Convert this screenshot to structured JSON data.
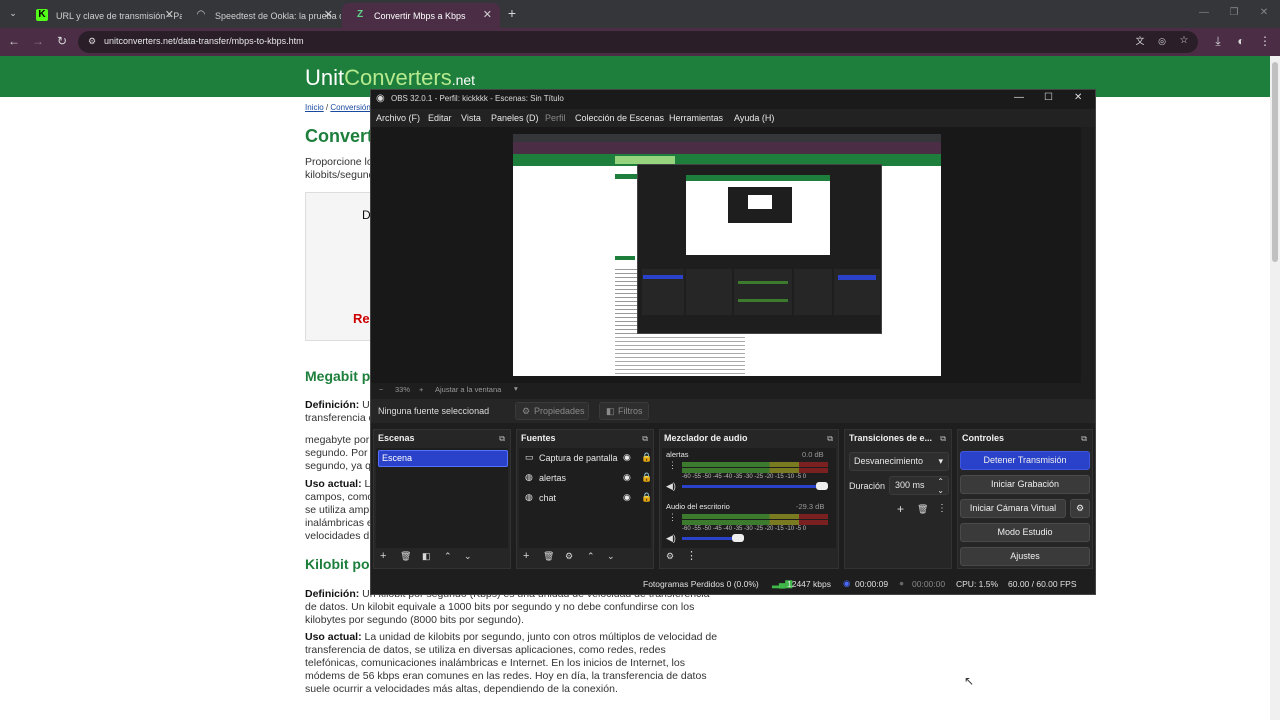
{
  "browser": {
    "tabs": [
      {
        "title": "URL y clave de transmisión - Pa",
        "icon": "kick-logo"
      },
      {
        "title": "Speedtest de Ookla: la prueba d",
        "icon": "speedtest-logo"
      },
      {
        "title": "Convertir Mbps a Kbps",
        "icon": "unitconverters-logo"
      }
    ],
    "url": "unitconverters.net/data-transfer/mbps-to-kbps.htm",
    "accent": "#4b2e46"
  },
  "page": {
    "logo_unit": "Unit",
    "logo_converters": "Converters",
    "logo_net": ".net",
    "breadcrumb_home": "Inicio",
    "breadcrumb_sep": " / ",
    "breadcrumb_conv": "Conversión d",
    "title": "Convert",
    "intro_1": "Proporcione lo",
    "intro_2": "kilobits/segund",
    "card_letter": "D",
    "card_red": "Re",
    "h_megabit": "Megabit p",
    "def_label": "Definición:",
    "def_1": "U",
    "def_2": "transferencia d",
    "mb_1": "megabyte por",
    "mb_2": "segundo. Por",
    "mb_3": "segundo, ya q",
    "uso_label": "Uso actual:",
    "uso_1": "L",
    "uso_2": "campos, como",
    "uso_3": "se utiliza ampl",
    "uso_4": "inalámbricas e",
    "uso_5": "velocidades d",
    "h_kilobit": "Kilobit po",
    "kb_def_1": "Un kilobit por segundo (Kbps) es una unidad de velocidad de transferencia",
    "kb_def_2": "de datos. Un kilobit equivale a 1000 bits por segundo y no debe confundirse con los",
    "kb_def_3": "kilobytes por segundo (8000 bits por segundo).",
    "kb_uso_1": "La unidad de kilobits por segundo, junto con otros múltiplos de velocidad de",
    "kb_uso_2": "transferencia de datos, se utiliza en diversas aplicaciones, como redes, redes",
    "kb_uso_3": "telefónicas, comunicaciones inalámbricas e Internet. En los inicios de Internet, los",
    "kb_uso_4": "módems de 56 kbps eran comunes en las redes. Hoy en día, la transferencia de datos",
    "kb_uso_5": "suele ocurrir a velocidades más altas, dependiendo de la conexión.",
    "accent": "#1d7f3b"
  },
  "obs": {
    "title": "OBS 32.0.1 - Perfil: kickkkk - Escenas: Sin Título",
    "menu": [
      "Archivo (F)",
      "Editar",
      "Vista",
      "Paneles (D)",
      "Perfil",
      "Colección de Escenas",
      "Herramientas",
      "Ayuda (H)"
    ],
    "zoom": "33%",
    "fit": "Ajustar a la ventana",
    "no_source": "Ninguna fuente seleccionad",
    "properties": "Propiedades",
    "filters": "Filtros",
    "docks": {
      "scenes": {
        "title": "Escenas",
        "items": [
          "Escena"
        ]
      },
      "sources": {
        "title": "Fuentes",
        "items": [
          "Captura de pantalla",
          "alertas",
          "chat"
        ]
      },
      "mixer": {
        "title": "Mezclador de audio",
        "channels": [
          {
            "name": "alertas",
            "db": "0.0 dB"
          },
          {
            "name": "Audio del escritorio",
            "db": "-29.3 dB"
          }
        ],
        "scale": "-60 -55 -50 -45 -40 -35 -30 -25 -20 -15 -10 -5 0"
      },
      "transitions": {
        "title": "Transiciones de e...",
        "selected": "Desvanecimiento",
        "duration_label": "Duración",
        "duration": "300 ms"
      },
      "controls": {
        "title": "Controles",
        "buttons": [
          "Detener Transmisión",
          "Iniciar Grabación",
          "Iniciar Cámara Virtual",
          "Modo Estudio",
          "Ajustes"
        ]
      }
    },
    "status": {
      "dropped": "Fotogramas Perdidos 0 (0.0%)",
      "bitrate": "12447 kbps",
      "stream_time": "00:00:09",
      "rec_time": "00:00:00",
      "cpu": "CPU: 1.5%",
      "fps": "60.00 / 60.00 FPS"
    },
    "primary_color": "#2a42c9"
  }
}
